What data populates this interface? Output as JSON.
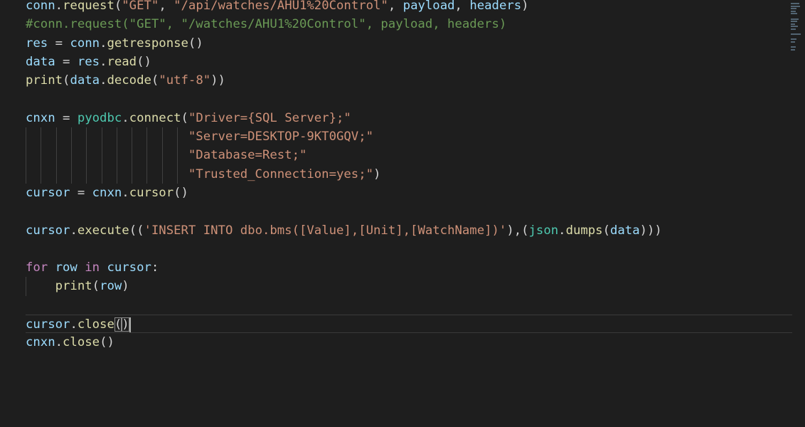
{
  "editor": {
    "lines": [
      {
        "tokens": [
          {
            "text": "conn",
            "cls": "v"
          },
          {
            "text": ".",
            "cls": "p"
          },
          {
            "text": "request",
            "cls": "f"
          },
          {
            "text": "(",
            "cls": "p"
          },
          {
            "text": "\"GET\"",
            "cls": "s"
          },
          {
            "text": ", ",
            "cls": "p"
          },
          {
            "text": "\"/api/watches/AHU1%20Control\"",
            "cls": "s"
          },
          {
            "text": ", ",
            "cls": "p"
          },
          {
            "text": "payload",
            "cls": "v"
          },
          {
            "text": ", ",
            "cls": "p"
          },
          {
            "text": "headers",
            "cls": "v"
          },
          {
            "text": ")",
            "cls": "p"
          }
        ]
      },
      {
        "tokens": [
          {
            "text": "#conn.request(\"GET\", \"/watches/AHU1%20Control\", payload, headers)",
            "cls": "c"
          }
        ]
      },
      {
        "tokens": [
          {
            "text": "res",
            "cls": "v"
          },
          {
            "text": " = ",
            "cls": "p"
          },
          {
            "text": "conn",
            "cls": "v"
          },
          {
            "text": ".",
            "cls": "p"
          },
          {
            "text": "getresponse",
            "cls": "f"
          },
          {
            "text": "()",
            "cls": "p"
          }
        ]
      },
      {
        "tokens": [
          {
            "text": "data",
            "cls": "v"
          },
          {
            "text": " = ",
            "cls": "p"
          },
          {
            "text": "res",
            "cls": "v"
          },
          {
            "text": ".",
            "cls": "p"
          },
          {
            "text": "read",
            "cls": "f"
          },
          {
            "text": "()",
            "cls": "p"
          }
        ]
      },
      {
        "tokens": [
          {
            "text": "print",
            "cls": "f"
          },
          {
            "text": "(",
            "cls": "p"
          },
          {
            "text": "data",
            "cls": "v"
          },
          {
            "text": ".",
            "cls": "p"
          },
          {
            "text": "decode",
            "cls": "f"
          },
          {
            "text": "(",
            "cls": "p"
          },
          {
            "text": "\"utf-8\"",
            "cls": "s"
          },
          {
            "text": "))",
            "cls": "p"
          }
        ]
      },
      {
        "tokens": []
      },
      {
        "tokens": [
          {
            "text": "cnxn",
            "cls": "v"
          },
          {
            "text": " = ",
            "cls": "p"
          },
          {
            "text": "pyodbc",
            "cls": "t"
          },
          {
            "text": ".",
            "cls": "p"
          },
          {
            "text": "connect",
            "cls": "f"
          },
          {
            "text": "(",
            "cls": "p"
          },
          {
            "text": "\"Driver={SQL Server};\"",
            "cls": "s"
          }
        ]
      },
      {
        "guides": 11,
        "tokens": [
          {
            "text": "                      ",
            "cls": "p"
          },
          {
            "text": "\"Server=DESKTOP-9KT0GQV;\"",
            "cls": "s"
          }
        ]
      },
      {
        "guides": 11,
        "tokens": [
          {
            "text": "                      ",
            "cls": "p"
          },
          {
            "text": "\"Database=Rest;\"",
            "cls": "s"
          }
        ]
      },
      {
        "guides": 11,
        "tokens": [
          {
            "text": "                      ",
            "cls": "p"
          },
          {
            "text": "\"Trusted_Connection=yes;\"",
            "cls": "s"
          },
          {
            "text": ")",
            "cls": "p"
          }
        ]
      },
      {
        "tokens": [
          {
            "text": "cursor",
            "cls": "v"
          },
          {
            "text": " = ",
            "cls": "p"
          },
          {
            "text": "cnxn",
            "cls": "v"
          },
          {
            "text": ".",
            "cls": "p"
          },
          {
            "text": "cursor",
            "cls": "f"
          },
          {
            "text": "()",
            "cls": "p"
          }
        ]
      },
      {
        "tokens": []
      },
      {
        "tokens": [
          {
            "text": "cursor",
            "cls": "v"
          },
          {
            "text": ".",
            "cls": "p"
          },
          {
            "text": "execute",
            "cls": "f"
          },
          {
            "text": "((",
            "cls": "p"
          },
          {
            "text": "'INSERT INTO dbo.bms([Value],[Unit],[WatchName])'",
            "cls": "s"
          },
          {
            "text": "),(",
            "cls": "p"
          },
          {
            "text": "json",
            "cls": "t"
          },
          {
            "text": ".",
            "cls": "p"
          },
          {
            "text": "dumps",
            "cls": "f"
          },
          {
            "text": "(",
            "cls": "p"
          },
          {
            "text": "data",
            "cls": "v"
          },
          {
            "text": ")))",
            "cls": "p"
          }
        ]
      },
      {
        "tokens": []
      },
      {
        "tokens": [
          {
            "text": "for",
            "cls": "kw"
          },
          {
            "text": " ",
            "cls": "p"
          },
          {
            "text": "row",
            "cls": "v"
          },
          {
            "text": " ",
            "cls": "p"
          },
          {
            "text": "in",
            "cls": "kw"
          },
          {
            "text": " ",
            "cls": "p"
          },
          {
            "text": "cursor",
            "cls": "v"
          },
          {
            "text": ":",
            "cls": "p"
          }
        ]
      },
      {
        "guides": 1,
        "tokens": [
          {
            "text": "    ",
            "cls": "p"
          },
          {
            "text": "print",
            "cls": "f"
          },
          {
            "text": "(",
            "cls": "p"
          },
          {
            "text": "row",
            "cls": "v"
          },
          {
            "text": ")",
            "cls": "p"
          }
        ]
      },
      {
        "tokens": []
      },
      {
        "current": true,
        "tokens": [
          {
            "text": "cursor",
            "cls": "v"
          },
          {
            "text": ".",
            "cls": "p"
          },
          {
            "text": "close",
            "cls": "f"
          },
          {
            "text": "(",
            "cls": "p bm"
          },
          {
            "text": ")",
            "cls": "p bm"
          }
        ],
        "caret": true
      },
      {
        "tokens": [
          {
            "text": "cnxn",
            "cls": "v"
          },
          {
            "text": ".",
            "cls": "p"
          },
          {
            "text": "close",
            "cls": "f"
          },
          {
            "text": "()",
            "cls": "p"
          }
        ]
      }
    ]
  },
  "colors": {
    "background": "#1e1e1e",
    "variable": "#9cdcfe",
    "function": "#dcdcaa",
    "string": "#ce9178",
    "comment": "#6a9955",
    "keyword": "#c586c0",
    "type": "#4ec9b0"
  },
  "icons": {
    "minimap": "minimap-icon"
  }
}
